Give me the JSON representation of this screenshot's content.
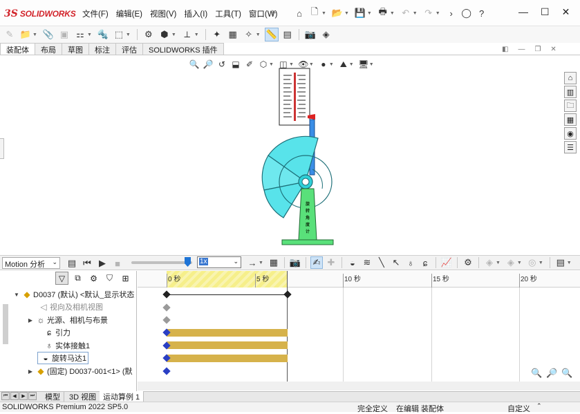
{
  "app": {
    "logo_ds": "3S",
    "logo_name": "SOLIDWORKS"
  },
  "menu": [
    "文件(F)",
    "编辑(E)",
    "视图(V)",
    "插入(I)",
    "工具(T)",
    "窗口(W)"
  ],
  "tabs": [
    "装配体",
    "布局",
    "草图",
    "标注",
    "评估",
    "SOLIDWORKS 插件"
  ],
  "motion": {
    "study_type": "Motion 分析",
    "speed": "1x"
  },
  "timeline": {
    "ticks": [
      "0 秒",
      "5 秒",
      "10 秒",
      "15 秒",
      "20 秒"
    ],
    "current_time_seconds": 6.9
  },
  "tree": {
    "root": "D0037 (默认) <默认_显示状态",
    "items": [
      "视向及相机视图",
      "光源、相机与布景",
      "引力",
      "实体接触1",
      "旋转马达1",
      "(固定) D0037-001<1> (默"
    ]
  },
  "bottom_tabs": [
    "模型",
    "3D 视图",
    "运动算例 1"
  ],
  "status": {
    "product": "SOLIDWORKS Premium 2022 SP5.0",
    "definition": "完全定义",
    "editing": "在编辑 装配体",
    "custom": "自定义"
  },
  "model": {
    "labels": [
      "旋",
      "转",
      "角",
      "度",
      "计"
    ]
  },
  "colors": {
    "accent": "#1e74d6",
    "bar": "#d6b24b",
    "fan": "#2fd0d8",
    "base": "#59e07a"
  }
}
